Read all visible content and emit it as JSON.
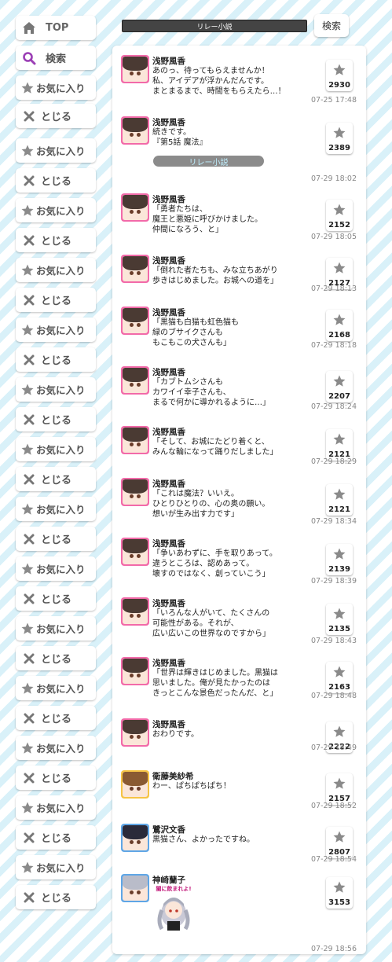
{
  "sidebar": {
    "top_label": "TOP",
    "search_label": "検索",
    "fav_label": "お気に入り",
    "close_label": "とじる"
  },
  "header": {
    "title": "リレー小説",
    "search_button": "検索"
  },
  "posts": [
    {
      "name": "浅野風香",
      "text": "あのっ、待ってもらえませんか！\n私、アイデアが浮かんだんです。\nまとまるまで、時間をもらえたら…！",
      "likes": "2930",
      "time": "07-25 17:48"
    },
    {
      "name": "浅野風香",
      "text": "続きです。\n『第5話 魔法』",
      "likes": "2389",
      "time": "07-29 18:02",
      "tag": "リレー小説"
    },
    {
      "name": "浅野風香",
      "text": "「勇者たちは、\n魔王と悪姫に呼びかけました。\n仲間になろう、と」",
      "likes": "2152",
      "time": "07-29 18:05"
    },
    {
      "name": "浅野風香",
      "text": "「倒れた者たちも、みな立ちあがり\n歩きはじめました。お城への道を」",
      "likes": "2127",
      "time": "07-29 18:13"
    },
    {
      "name": "浅野風香",
      "text": "「黒猫も白猫も虹色猫も\n緑のブサイクさんも\nもこもこの犬さんも」",
      "likes": "2168",
      "time": "07-29 18:18"
    },
    {
      "name": "浅野風香",
      "text": "「カブトムシさんも\nカワイイ幸子さんも、\nまるで何かに導かれるように…」",
      "likes": "2207",
      "time": "07-29 18:24"
    },
    {
      "name": "浅野風香",
      "text": "「そして、お城にたどり着くと、\nみんな輪になって踊りだしました」",
      "likes": "2121",
      "time": "07-29 18:29"
    },
    {
      "name": "浅野風香",
      "text": "「これは魔法？いいえ。\nひとりひとりの、心の奥の願い。\n想いが生み出す力です」",
      "likes": "2121",
      "time": "07-29 18:34"
    },
    {
      "name": "浅野風香",
      "text": "「争いあわずに、手を取りあって。\n違うところは、認めあって。\n壊すのではなく、創っていこう」",
      "likes": "2139",
      "time": "07-29 18:39"
    },
    {
      "name": "浅野風香",
      "text": "「いろんな人がいて、たくさんの\n可能性がある。それが、\n広い広いこの世界なのですから」",
      "likes": "2135",
      "time": "07-29 18:43"
    },
    {
      "name": "浅野風香",
      "text": "「世界は輝きはじめました。黒猫は\n思いました。俺が見たかったのは\nきっとこんな景色だったんだ、と」",
      "likes": "2163",
      "time": "07-29 18:48"
    },
    {
      "name": "浅野風香",
      "text": "おわりです。",
      "likes": "2222",
      "time": "07-29 18:49"
    },
    {
      "name": "衛藤美紗希",
      "text": "わー、ぱちぱちぱち！",
      "likes": "2157",
      "time": "07-29 18:52"
    },
    {
      "name": "鷺沢文香",
      "text": "黒猫さん、よかったですね。",
      "likes": "2807",
      "time": "07-29 18:54"
    },
    {
      "name": "神崎蘭子",
      "text": "",
      "likes": "3153",
      "time": "07-29 18:56",
      "sticker_text": "闇に飲まれよ!"
    }
  ],
  "colors": {
    "stripe": "#d9f1f9",
    "tag_bg": "#8b8b8b",
    "tag_text": "#bff0ff",
    "search_accent": "#9b3fb5"
  }
}
